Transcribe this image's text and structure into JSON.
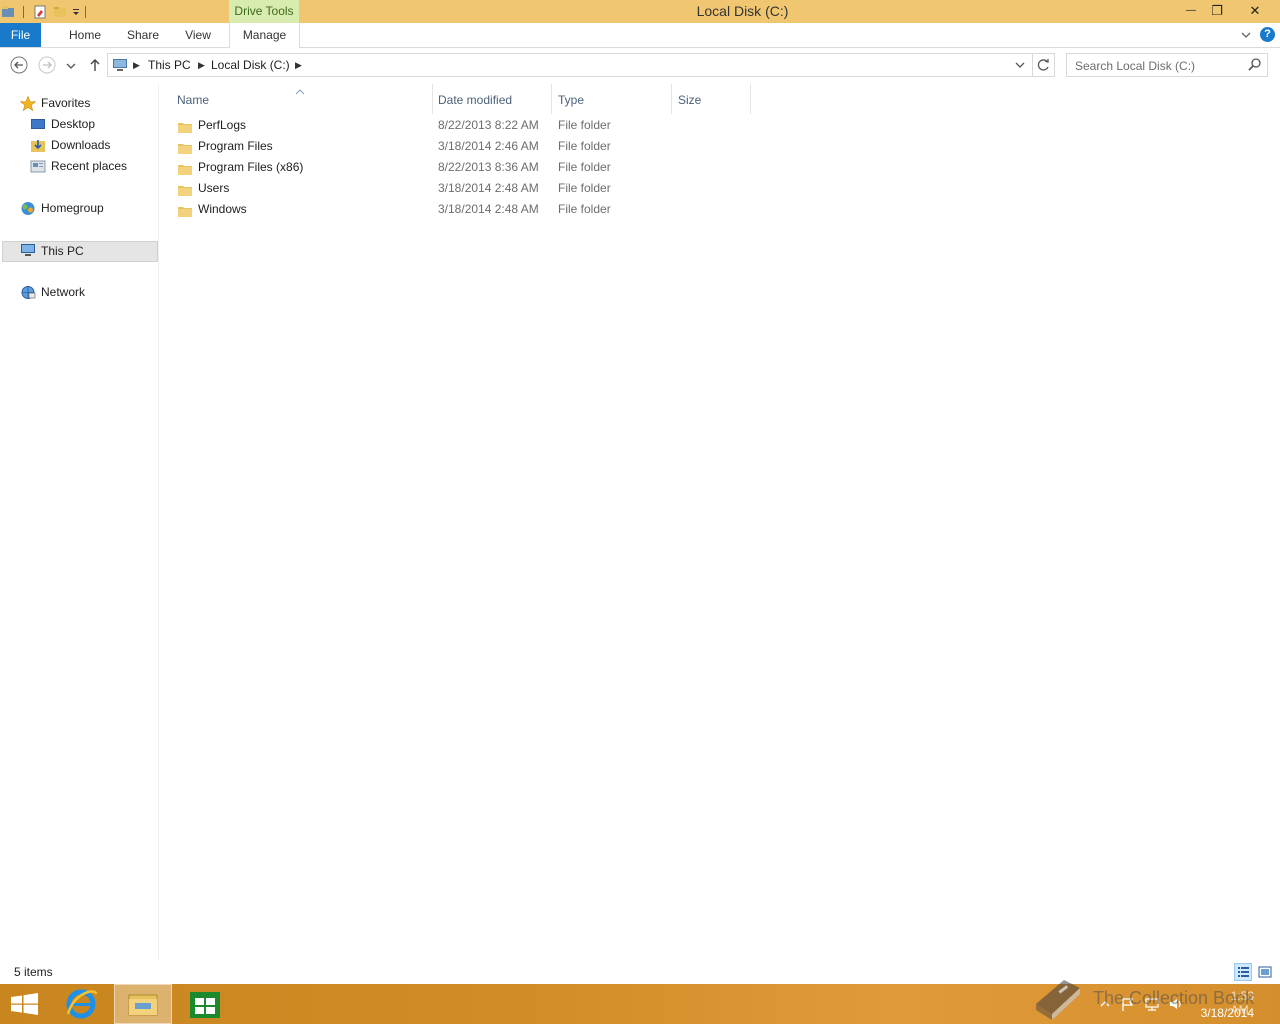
{
  "window": {
    "title": "Local Disk (C:)",
    "contextual_tab": "Drive Tools",
    "minimize_glyph": "—",
    "restore_glyph": "❐",
    "close_glyph": "✕"
  },
  "ribbon": {
    "tabs": [
      {
        "label": "File"
      },
      {
        "label": "Home"
      },
      {
        "label": "Share"
      },
      {
        "label": "View"
      },
      {
        "label": "Manage"
      }
    ],
    "help_glyph": "?"
  },
  "address": {
    "crumbs": [
      "This PC",
      "Local Disk (C:)"
    ],
    "search_placeholder": "Search Local Disk (C:)"
  },
  "navpane": {
    "favorites_label": "Favorites",
    "favorites": [
      "Desktop",
      "Downloads",
      "Recent places"
    ],
    "homegroup_label": "Homegroup",
    "thispc_label": "This PC",
    "network_label": "Network"
  },
  "columns": {
    "name": "Name",
    "date": "Date modified",
    "type": "Type",
    "size": "Size"
  },
  "files": [
    {
      "name": "PerfLogs",
      "date": "8/22/2013 8:22 AM",
      "type": "File folder"
    },
    {
      "name": "Program Files",
      "date": "3/18/2014 2:46 AM",
      "type": "File folder"
    },
    {
      "name": "Program Files (x86)",
      "date": "8/22/2013 8:36 AM",
      "type": "File folder"
    },
    {
      "name": "Users",
      "date": "3/18/2014 2:48 AM",
      "type": "File folder"
    },
    {
      "name": "Windows",
      "date": "3/18/2014 2:48 AM",
      "type": "File folder"
    }
  ],
  "status": {
    "count": "5 items"
  },
  "taskbar": {
    "clock_time": "1:53 AM",
    "clock_date": "3/18/2014"
  },
  "watermark": {
    "text": "The Collection Book"
  },
  "colors": {
    "titlebar": "#f0c770",
    "file_tab": "#1979ca",
    "contextual": "#d9ecb0",
    "folder": "#e8c35c"
  }
}
